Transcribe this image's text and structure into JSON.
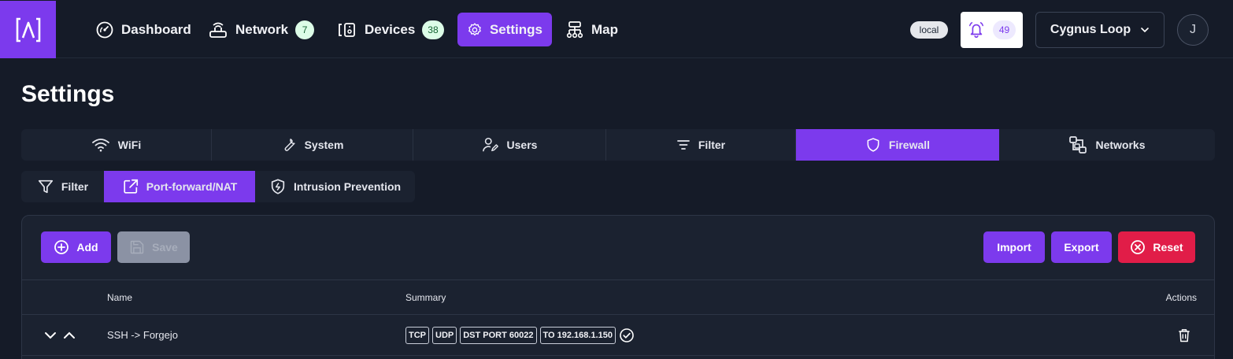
{
  "nav": {
    "logo_icon": "bracket-lambda-logo",
    "items": [
      {
        "label": "Dashboard",
        "icon": "gauge-icon"
      },
      {
        "label": "Network",
        "icon": "router-icon",
        "badge": "7"
      },
      {
        "label": "Devices",
        "icon": "devices-icon",
        "badge": "38"
      },
      {
        "label": "Settings",
        "icon": "gear-icon",
        "active": true
      },
      {
        "label": "Map",
        "icon": "sitemap-icon"
      }
    ],
    "env_badge": "local",
    "notifications": {
      "icon": "bell-ringing-icon",
      "count": "49"
    },
    "site_selector": {
      "value": "Cygnus Loop"
    },
    "avatar_initial": "J"
  },
  "page": {
    "title": "Settings"
  },
  "main_tabs": [
    {
      "label": "WiFi",
      "icon": "wifi-icon"
    },
    {
      "label": "System",
      "icon": "wrench-icon"
    },
    {
      "label": "Users",
      "icon": "user-edit-icon"
    },
    {
      "label": "Filter",
      "icon": "filter-lines-icon"
    },
    {
      "label": "Firewall",
      "icon": "shield-icon",
      "active": true
    },
    {
      "label": "Networks",
      "icon": "network-icon"
    }
  ],
  "sub_tabs": [
    {
      "label": "Filter",
      "icon": "funnel-icon"
    },
    {
      "label": "Port-forward/NAT",
      "icon": "external-link-icon",
      "active": true
    },
    {
      "label": "Intrusion Prevention",
      "icon": "shield-bolt-icon"
    }
  ],
  "toolbar": {
    "add_label": "Add",
    "save_label": "Save",
    "import_label": "Import",
    "export_label": "Export",
    "reset_label": "Reset"
  },
  "table": {
    "columns": [
      "Name",
      "Summary",
      "Actions"
    ],
    "rows": [
      {
        "name": "SSH -> Forgejo",
        "tags": [
          "TCP",
          "UDP",
          "DST PORT 60022",
          "TO 192.168.1.150"
        ],
        "enabled": true
      }
    ]
  },
  "colors": {
    "accent": "#7c3aed",
    "danger": "#e11d48",
    "background": "#151b28",
    "surface": "#1b2230",
    "badge_green_bg": "#dcfce7"
  }
}
